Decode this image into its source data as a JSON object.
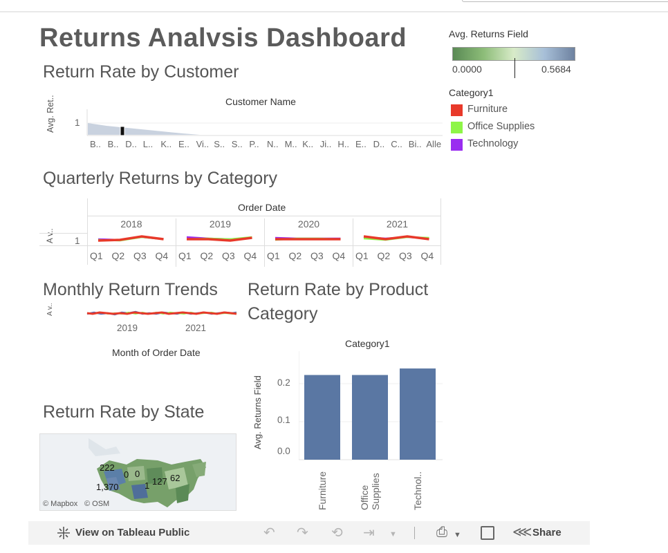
{
  "dashboard": {
    "title": "Returns Analvsis Dashboard"
  },
  "legend": {
    "color_title": "Avg. Returns Field",
    "min_label": "0.0000",
    "max_label": "0.5684",
    "gradient_colors": [
      "#5a8a55",
      "#8cbc78",
      "#d8ebc8",
      "#a7bfd8",
      "#6e82a0"
    ],
    "category_title": "Category1",
    "categories": [
      {
        "label": "Furniture",
        "color": "#e8392a"
      },
      {
        "label": "Office Supplies",
        "color": "#8ef547"
      },
      {
        "label": "Technology",
        "color": "#9a2df0"
      }
    ]
  },
  "customer_chart": {
    "title": "Return Rate by Customer",
    "header": "Customer Name",
    "y_label": "Avg. Ret..",
    "y_tick": "1",
    "x_ticks": [
      "B..",
      "B..",
      "D..",
      "L..",
      "K..",
      "E..",
      "Vi..",
      "S..",
      "S..",
      "P..",
      "N..",
      "M..",
      "K..",
      "Ji..",
      "H..",
      "E..",
      "D..",
      "C..",
      "Bi..",
      "Alle"
    ]
  },
  "quarterly_chart": {
    "title": "Quarterly Returns by Category",
    "header": "Order Date",
    "y_label": "A v..",
    "y_tick": "1",
    "years": [
      "2018",
      "2019",
      "2020",
      "2021"
    ],
    "quarters": [
      "Q1",
      "Q2",
      "Q3",
      "Q4"
    ]
  },
  "monthly_chart": {
    "title": "Monthly Return Trends",
    "y_label": "A v..",
    "x_ticks": [
      "2019",
      "2021"
    ],
    "x_label": "Month of Order Date"
  },
  "product_chart": {
    "title_line1": "Return Rate by Product",
    "title_line2": "Category",
    "header": "Category1",
    "y_label": "Avg. Returns Field",
    "y_ticks": [
      "0.2",
      "0.1",
      "0.0"
    ]
  },
  "chart_data": {
    "type": "bar",
    "categories": [
      "Furniture",
      "Office Supplies",
      "Technol.."
    ],
    "values": [
      0.26,
      0.26,
      0.28
    ],
    "ylabel": "Avg. Returns Field",
    "ylim": [
      0,
      0.3
    ],
    "color": "#5a77a3"
  },
  "map": {
    "title": "Return Rate by State",
    "labels": [
      "222",
      "0",
      "0",
      "1,370",
      "1",
      "127",
      "62"
    ],
    "attribution_mapbox": "© Mapbox",
    "attribution_osm": "© OSM"
  },
  "toolbar": {
    "view_label": "View on Tableau Public",
    "share_label": "Share"
  }
}
